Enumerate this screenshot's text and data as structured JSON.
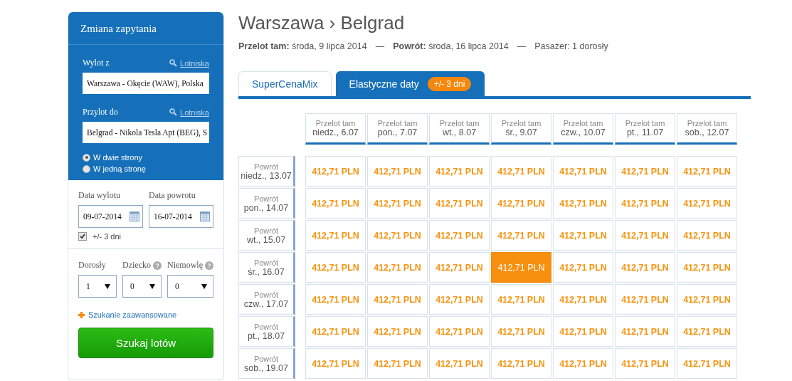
{
  "sidebar": {
    "title": "Zmiana zapytania",
    "from": {
      "label": "Wylot z",
      "link": "Lotniska",
      "value": "Warszawa - Okęcie (WAW), Polska"
    },
    "to": {
      "label": "Przylot do",
      "link": "Lotniska",
      "value": "Belgrad - Nikola Tesla Apt (BEG), S"
    },
    "trip_types": [
      {
        "label": "W dwie strony",
        "selected": true
      },
      {
        "label": "W jedną stronę",
        "selected": false
      }
    ],
    "departure_date": {
      "label": "Data wylotu",
      "value": "09-07-2014"
    },
    "return_date": {
      "label": "Data powrotu",
      "value": "16-07-2014"
    },
    "flexible": {
      "label": "+/- 3 dni",
      "checked": true
    },
    "passengers": [
      {
        "label": "Dorosły",
        "value": "1",
        "help": false
      },
      {
        "label": "Dziecko",
        "value": "0",
        "help": true
      },
      {
        "label": "Niemowlę",
        "value": "0",
        "help": true
      }
    ],
    "advanced_link": "Szukanie zaawansowane",
    "search_button": "Szukaj lotów"
  },
  "heading": "Warszawa › Belgrad",
  "summary": {
    "outbound_label": "Przelot tam:",
    "outbound": "środa, 9 lipca 2014",
    "return_label": "Powrót:",
    "return": "środa, 16 lipca 2014",
    "separator": "—",
    "passengers": "Pasażer: 1 dorosły"
  },
  "tabs": [
    {
      "label": "SuperCenaMix",
      "selected": false
    },
    {
      "label": "Elastyczne daty",
      "badge": "+/- 3 dni",
      "selected": true
    }
  ],
  "columns": [
    {
      "label": "Przelot tam",
      "day": "niedz., 6.07"
    },
    {
      "label": "Przelot tam",
      "day": "pon., 7.07"
    },
    {
      "label": "Przelot tam",
      "day": "wt., 8.07"
    },
    {
      "label": "Przelot tam",
      "day": "śr., 9.07"
    },
    {
      "label": "Przelot tam",
      "day": "czw., 10.07"
    },
    {
      "label": "Przelot tam",
      "day": "pt., 11.07"
    },
    {
      "label": "Przelot tam",
      "day": "sob., 12.07"
    }
  ],
  "rows": [
    {
      "label": "Powrót",
      "day": "niedz., 13.07",
      "cells": [
        {
          "price": "412,71 PLN",
          "selected": false
        },
        {
          "price": "412,71 PLN",
          "selected": false
        },
        {
          "price": "412,71 PLN",
          "selected": false
        },
        {
          "price": "412,71 PLN",
          "selected": false
        },
        {
          "price": "412,71 PLN",
          "selected": false
        },
        {
          "price": "412,71 PLN",
          "selected": false
        },
        {
          "price": "412,71 PLN",
          "selected": false
        }
      ]
    },
    {
      "label": "Powrót",
      "day": "pon., 14.07",
      "cells": [
        {
          "price": "412,71 PLN",
          "selected": false
        },
        {
          "price": "412,71 PLN",
          "selected": false
        },
        {
          "price": "412,71 PLN",
          "selected": false
        },
        {
          "price": "412,71 PLN",
          "selected": false
        },
        {
          "price": "412,71 PLN",
          "selected": false
        },
        {
          "price": "412,71 PLN",
          "selected": false
        },
        {
          "price": "412,71 PLN",
          "selected": false
        }
      ]
    },
    {
      "label": "Powrót",
      "day": "wt., 15.07",
      "cells": [
        {
          "price": "412,71 PLN",
          "selected": false
        },
        {
          "price": "412,71 PLN",
          "selected": false
        },
        {
          "price": "412,71 PLN",
          "selected": false
        },
        {
          "price": "412,71 PLN",
          "selected": false
        },
        {
          "price": "412,71 PLN",
          "selected": false
        },
        {
          "price": "412,71 PLN",
          "selected": false
        },
        {
          "price": "412,71 PLN",
          "selected": false
        }
      ]
    },
    {
      "label": "Powrót",
      "day": "śr., 16.07",
      "cells": [
        {
          "price": "412,71 PLN",
          "selected": false
        },
        {
          "price": "412,71 PLN",
          "selected": false
        },
        {
          "price": "412,71 PLN",
          "selected": false
        },
        {
          "price": "412,71 PLN",
          "selected": true
        },
        {
          "price": "412,71 PLN",
          "selected": false
        },
        {
          "price": "412,71 PLN",
          "selected": false
        },
        {
          "price": "412,71 PLN",
          "selected": false
        }
      ]
    },
    {
      "label": "Powrót",
      "day": "czw., 17.07",
      "cells": [
        {
          "price": "412,71 PLN",
          "selected": false
        },
        {
          "price": "412,71 PLN",
          "selected": false
        },
        {
          "price": "412,71 PLN",
          "selected": false
        },
        {
          "price": "412,71 PLN",
          "selected": false
        },
        {
          "price": "412,71 PLN",
          "selected": false
        },
        {
          "price": "412,71 PLN",
          "selected": false
        },
        {
          "price": "412,71 PLN",
          "selected": false
        }
      ]
    },
    {
      "label": "Powrót",
      "day": "pt., 18.07",
      "cells": [
        {
          "price": "412,71 PLN",
          "selected": false
        },
        {
          "price": "412,71 PLN",
          "selected": false
        },
        {
          "price": "412,71 PLN",
          "selected": false
        },
        {
          "price": "412,71 PLN",
          "selected": false
        },
        {
          "price": "412,71 PLN",
          "selected": false
        },
        {
          "price": "412,71 PLN",
          "selected": false
        },
        {
          "price": "412,71 PLN",
          "selected": false
        }
      ]
    },
    {
      "label": "Powrót",
      "day": "sob., 19.07",
      "cells": [
        {
          "price": "412,71 PLN",
          "selected": false
        },
        {
          "price": "412,71 PLN",
          "selected": false
        },
        {
          "price": "412,71 PLN",
          "selected": false
        },
        {
          "price": "412,71 PLN",
          "selected": false
        },
        {
          "price": "412,71 PLN",
          "selected": false
        },
        {
          "price": "412,71 PLN",
          "selected": false
        },
        {
          "price": "412,71 PLN",
          "selected": false
        }
      ]
    }
  ]
}
